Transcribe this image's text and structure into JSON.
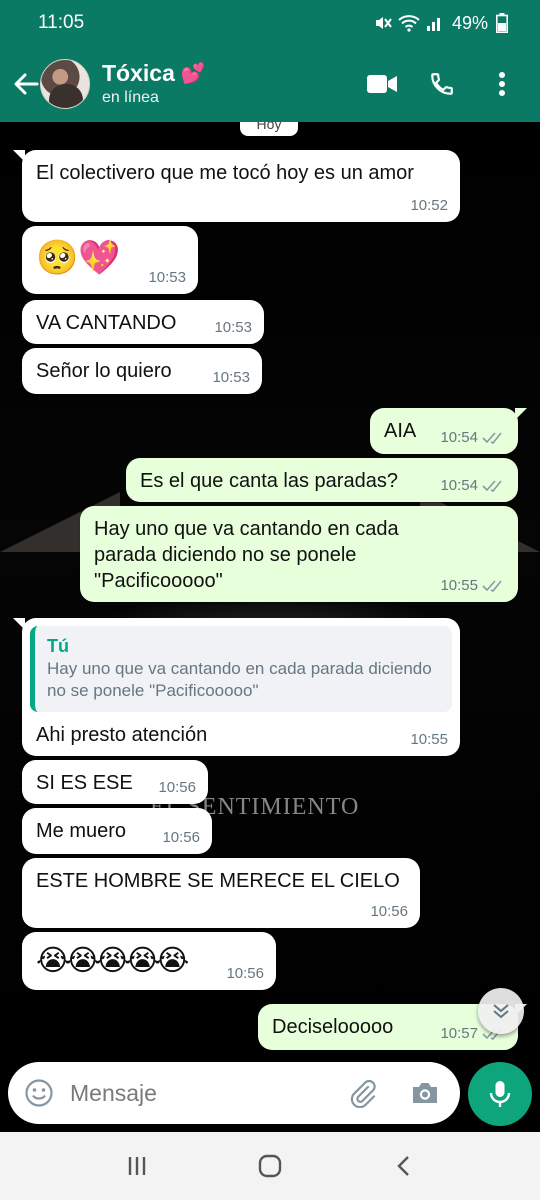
{
  "status_bar": {
    "time": "11:05",
    "battery": "49%"
  },
  "header": {
    "contact_name": "Tóxica",
    "name_emoji": "💕",
    "status": "en línea"
  },
  "chat": {
    "date_chip": "Hoy",
    "watermark": "EL SENTIMIENTO",
    "messages": [
      {
        "side": "in",
        "text": "El colectivero que me tocó hoy es un amor",
        "time": "10:52"
      },
      {
        "side": "in",
        "text": "🥺💖",
        "time": "10:53"
      },
      {
        "side": "in",
        "text": "VA CANTANDO",
        "time": "10:53"
      },
      {
        "side": "in",
        "text": "Señor lo quiero",
        "time": "10:53"
      },
      {
        "side": "out",
        "text": "AIA",
        "time": "10:54"
      },
      {
        "side": "out",
        "text": "Es el que canta las paradas?",
        "time": "10:54"
      },
      {
        "side": "out",
        "text": "Hay uno que va cantando en cada parada diciendo no se ponele \"Pacificooooo\"",
        "time": "10:55"
      },
      {
        "side": "in",
        "quote_author": "Tú",
        "quote_text": "Hay uno que va cantando en cada parada diciendo no se ponele \"Pacificooooo\"",
        "text": "Ahi presto atención",
        "time": "10:55"
      },
      {
        "side": "in",
        "text": "SI ES ESE",
        "time": "10:56"
      },
      {
        "side": "in",
        "text": "Me muero",
        "time": "10:56"
      },
      {
        "side": "in",
        "text": "ESTE HOMBRE SE MERECE EL CIELO",
        "time": "10:56"
      },
      {
        "side": "in",
        "text": "😭😭😭😭😭",
        "time": "10:56"
      },
      {
        "side": "out",
        "text": "Deciselooooo",
        "time": "10:57"
      }
    ]
  },
  "composer": {
    "placeholder": "Mensaje"
  },
  "colors": {
    "header": "#0a7a64",
    "outgoing_bubble": "#e7ffdb",
    "incoming_bubble": "#ffffff",
    "mic": "#0ea57c",
    "quote_accent": "#06a884"
  },
  "icons": [
    "back-arrow-icon",
    "video-call-icon",
    "phone-icon",
    "more-icon",
    "emoji-icon",
    "attach-icon",
    "camera-icon",
    "mic-icon",
    "double-check-icon",
    "chevron-down-icon",
    "recents-icon",
    "home-icon",
    "nav-back-icon"
  ]
}
